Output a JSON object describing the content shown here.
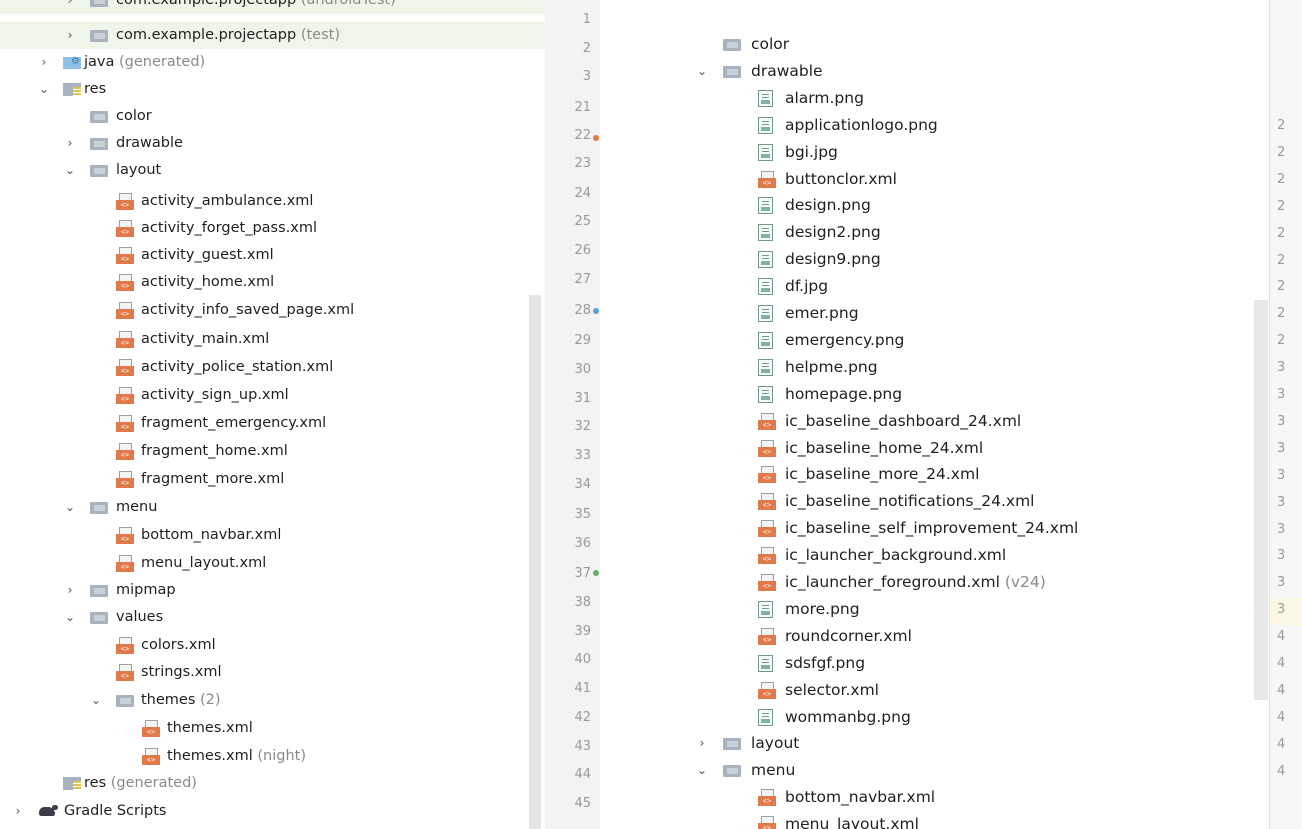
{
  "left_panel": {
    "tree": [
      {
        "label": "com.example.projectapp",
        "suffix": "(androidTest)",
        "icon": "folder-icon",
        "arrow": "›"
      },
      {
        "label": "com.example.projectapp",
        "suffix": "(test)",
        "icon": "folder-icon",
        "arrow": "›"
      },
      {
        "label": "java",
        "suffix": "(generated)",
        "icon": "generated-folder-icon",
        "arrow": "›"
      },
      {
        "label": "res",
        "suffix": "",
        "icon": "res-folder-icon",
        "arrow": "⌄"
      },
      {
        "label": "color",
        "suffix": "",
        "icon": "folder-icon",
        "arrow": ""
      },
      {
        "label": "drawable",
        "suffix": "",
        "icon": "folder-icon",
        "arrow": "›"
      },
      {
        "label": "layout",
        "suffix": "",
        "icon": "folder-icon",
        "arrow": "⌄"
      },
      {
        "label": "activity_ambulance.xml",
        "suffix": "",
        "icon": "xml-file-icon",
        "arrow": ""
      },
      {
        "label": "activity_forget_pass.xml",
        "suffix": "",
        "icon": "xml-file-icon",
        "arrow": ""
      },
      {
        "label": "activity_guest.xml",
        "suffix": "",
        "icon": "xml-file-icon",
        "arrow": ""
      },
      {
        "label": "activity_home.xml",
        "suffix": "",
        "icon": "xml-file-icon",
        "arrow": ""
      },
      {
        "label": "activity_info_saved_page.xml",
        "suffix": "",
        "icon": "xml-file-icon",
        "arrow": ""
      },
      {
        "label": "activity_main.xml",
        "suffix": "",
        "icon": "xml-file-icon",
        "arrow": ""
      },
      {
        "label": "activity_police_station.xml",
        "suffix": "",
        "icon": "xml-file-icon",
        "arrow": ""
      },
      {
        "label": "activity_sign_up.xml",
        "suffix": "",
        "icon": "xml-file-icon",
        "arrow": ""
      },
      {
        "label": "fragment_emergency.xml",
        "suffix": "",
        "icon": "xml-file-icon",
        "arrow": ""
      },
      {
        "label": "fragment_home.xml",
        "suffix": "",
        "icon": "xml-file-icon",
        "arrow": ""
      },
      {
        "label": "fragment_more.xml",
        "suffix": "",
        "icon": "xml-file-icon",
        "arrow": ""
      },
      {
        "label": "menu",
        "suffix": "",
        "icon": "folder-icon",
        "arrow": "⌄"
      },
      {
        "label": "bottom_navbar.xml",
        "suffix": "",
        "icon": "xml-file-icon",
        "arrow": ""
      },
      {
        "label": "menu_layout.xml",
        "suffix": "",
        "icon": "xml-file-icon",
        "arrow": ""
      },
      {
        "label": "mipmap",
        "suffix": "",
        "icon": "folder-icon",
        "arrow": "›"
      },
      {
        "label": "values",
        "suffix": "",
        "icon": "folder-icon",
        "arrow": "⌄"
      },
      {
        "label": "colors.xml",
        "suffix": "",
        "icon": "xml-file-icon",
        "arrow": ""
      },
      {
        "label": "strings.xml",
        "suffix": "",
        "icon": "xml-file-icon",
        "arrow": ""
      },
      {
        "label": "themes",
        "suffix": "(2)",
        "icon": "folder-icon",
        "arrow": "⌄"
      },
      {
        "label": "themes.xml",
        "suffix": "",
        "icon": "xml-file-icon",
        "arrow": ""
      },
      {
        "label": "themes.xml",
        "suffix": "(night)",
        "icon": "xml-file-icon",
        "arrow": ""
      },
      {
        "label": "res",
        "suffix": "(generated)",
        "icon": "res-folder-icon",
        "arrow": ""
      },
      {
        "label": "Gradle Scripts",
        "suffix": "",
        "icon": "gradle-icon",
        "arrow": "›"
      }
    ],
    "gutter_lines": [
      "1",
      "2",
      "3",
      "21",
      "22",
      "23",
      "24",
      "25",
      "26",
      "27",
      "28",
      "29",
      "30",
      "31",
      "32",
      "33",
      "34",
      "35",
      "36",
      "37",
      "38",
      "39",
      "40",
      "41",
      "42",
      "43",
      "44",
      "45"
    ]
  },
  "right_panel": {
    "tree": [
      {
        "label": "color",
        "suffix": "",
        "icon": "folder-icon",
        "arrow": ""
      },
      {
        "label": "drawable",
        "suffix": "",
        "icon": "folder-icon",
        "arrow": "⌄"
      },
      {
        "label": "alarm.png",
        "suffix": "",
        "icon": "image-file-icon",
        "arrow": ""
      },
      {
        "label": "applicationlogo.png",
        "suffix": "",
        "icon": "image-file-icon",
        "arrow": ""
      },
      {
        "label": "bgi.jpg",
        "suffix": "",
        "icon": "image-file-icon",
        "arrow": ""
      },
      {
        "label": "buttonclor.xml",
        "suffix": "",
        "icon": "xml-file-icon",
        "arrow": ""
      },
      {
        "label": "design.png",
        "suffix": "",
        "icon": "image-file-icon",
        "arrow": ""
      },
      {
        "label": "design2.png",
        "suffix": "",
        "icon": "image-file-icon",
        "arrow": ""
      },
      {
        "label": "design9.png",
        "suffix": "",
        "icon": "image-file-icon",
        "arrow": ""
      },
      {
        "label": "df.jpg",
        "suffix": "",
        "icon": "image-file-icon",
        "arrow": ""
      },
      {
        "label": "emer.png",
        "suffix": "",
        "icon": "image-file-icon",
        "arrow": ""
      },
      {
        "label": "emergency.png",
        "suffix": "",
        "icon": "image-file-icon",
        "arrow": ""
      },
      {
        "label": "helpme.png",
        "suffix": "",
        "icon": "image-file-icon",
        "arrow": ""
      },
      {
        "label": "homepage.png",
        "suffix": "",
        "icon": "image-file-icon",
        "arrow": ""
      },
      {
        "label": "ic_baseline_dashboard_24.xml",
        "suffix": "",
        "icon": "xml-file-icon",
        "arrow": ""
      },
      {
        "label": "ic_baseline_home_24.xml",
        "suffix": "",
        "icon": "xml-file-icon",
        "arrow": ""
      },
      {
        "label": "ic_baseline_more_24.xml",
        "suffix": "",
        "icon": "xml-file-icon",
        "arrow": ""
      },
      {
        "label": "ic_baseline_notifications_24.xml",
        "suffix": "",
        "icon": "xml-file-icon",
        "arrow": ""
      },
      {
        "label": "ic_baseline_self_improvement_24.xml",
        "suffix": "",
        "icon": "xml-file-icon",
        "arrow": ""
      },
      {
        "label": "ic_launcher_background.xml",
        "suffix": "",
        "icon": "xml-file-icon",
        "arrow": ""
      },
      {
        "label": "ic_launcher_foreground.xml",
        "suffix": "(v24)",
        "icon": "xml-file-icon",
        "arrow": ""
      },
      {
        "label": "more.png",
        "suffix": "",
        "icon": "image-file-icon",
        "arrow": ""
      },
      {
        "label": "roundcorner.xml",
        "suffix": "",
        "icon": "xml-file-icon",
        "arrow": ""
      },
      {
        "label": "sdsfgf.png",
        "suffix": "",
        "icon": "image-file-icon",
        "arrow": ""
      },
      {
        "label": "selector.xml",
        "suffix": "",
        "icon": "xml-file-icon",
        "arrow": ""
      },
      {
        "label": "wommanbg.png",
        "suffix": "",
        "icon": "image-file-icon",
        "arrow": ""
      },
      {
        "label": "layout",
        "suffix": "",
        "icon": "folder-icon",
        "arrow": "›"
      },
      {
        "label": "menu",
        "suffix": "",
        "icon": "folder-icon",
        "arrow": "⌄"
      },
      {
        "label": "bottom_navbar.xml",
        "suffix": "",
        "icon": "xml-file-icon",
        "arrow": ""
      },
      {
        "label": "menu_layout.xml",
        "suffix": "",
        "icon": "xml-file-icon",
        "arrow": ""
      }
    ],
    "gutter_lines": [
      "2",
      "2",
      "2",
      "2",
      "2",
      "2",
      "2",
      "2",
      "2",
      "3",
      "3",
      "3",
      "3",
      "3",
      "3",
      "3",
      "3",
      "3",
      "3",
      "4",
      "4",
      "4",
      "4",
      "4",
      "4"
    ]
  },
  "colors": {
    "highlight_row": "#eef6e9",
    "suffix_gray": "#8a8a8a",
    "xml_badge": "#e07a4b",
    "folder": "#a9b3bf"
  }
}
